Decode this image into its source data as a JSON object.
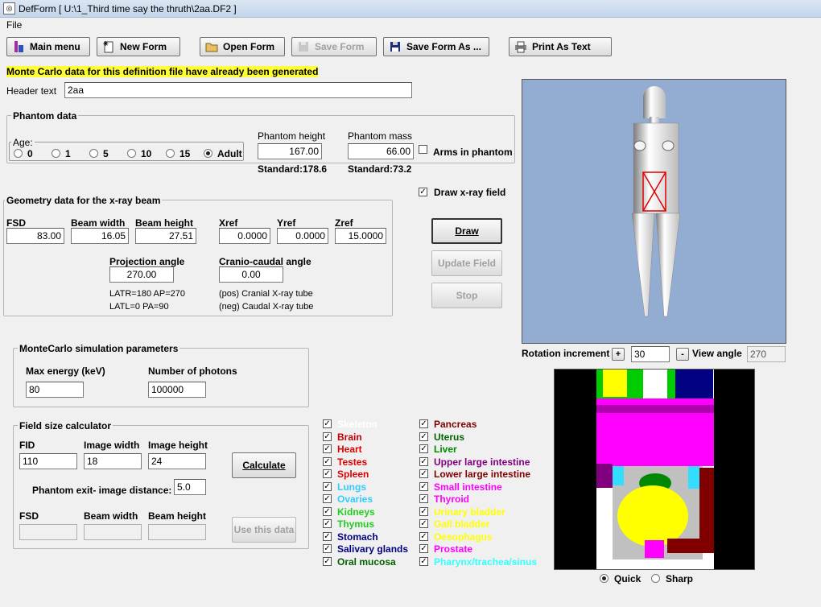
{
  "window": {
    "title": "DefForm  [ U:\\1_Third time say the thruth\\2aa.DF2 ]"
  },
  "menu": {
    "file": "File"
  },
  "toolbar": {
    "main_menu": "Main menu",
    "new_form": "New Form",
    "open_form": "Open Form",
    "save_form": "Save Form",
    "save_form_as": "Save Form As ...",
    "print_as_text": "Print As Text"
  },
  "warning": "Monte Carlo data for this definition file have already been  generated",
  "header": {
    "label": "Header text",
    "value": "2aa"
  },
  "phantom": {
    "title": "Phantom data",
    "age_label": "Age:",
    "ages": [
      "0",
      "1",
      "5",
      "10",
      "15",
      "Adult"
    ],
    "selected_age": "Adult",
    "height_label": "Phantom height",
    "height_value": "167.00",
    "height_standard": "Standard:178.6",
    "mass_label": "Phantom mass",
    "mass_value": "66.00",
    "mass_standard": "Standard:73.2",
    "arms_label": "Arms in phantom"
  },
  "geometry": {
    "title": "Geometry data for the x-ray beam",
    "fsd_label": "FSD",
    "fsd": "83.00",
    "bw_label": "Beam width",
    "bw": "16.05",
    "bh_label": "Beam height",
    "bh": "27.51",
    "xref_label": "Xref",
    "xref": "0.0000",
    "yref_label": "Yref",
    "yref": "0.0000",
    "zref_label": "Zref",
    "zref": "15.0000",
    "proj_label": "Projection angle",
    "proj": "270.00",
    "cc_label": "Cranio-caudal angle",
    "cc": "0.00",
    "note1": "LATR=180  AP=270",
    "note2": "LATL=0     PA=90",
    "note3": "(pos) Cranial X-ray tube",
    "note4": "(neg) Caudal X-ray tube"
  },
  "draw_field": {
    "label": "Draw x-ray field"
  },
  "actions": {
    "draw": "Draw",
    "update": "Update Field",
    "stop": "Stop"
  },
  "montecarlo": {
    "title": "MonteCarlo simulation parameters",
    "energy_label": "Max energy (keV)",
    "energy": "80",
    "photons_label": "Number of photons",
    "photons": "100000"
  },
  "fieldcalc": {
    "title": "Field size calculator",
    "fid_label": "FID",
    "fid": "110",
    "iw_label": "Image width",
    "iw": "18",
    "ih_label": "Image height",
    "ih": "24",
    "calculate": "Calculate",
    "exit_label": "Phantom exit- image distance:",
    "exit": "5.0",
    "fsd_label": "FSD",
    "bw_label": "Beam width",
    "bh_label": "Beam height",
    "use": "Use this data"
  },
  "rotation": {
    "label": "Rotation increment",
    "plus": "+",
    "value": "30",
    "minus": "-",
    "view_label": "View angle",
    "view": "270"
  },
  "render_mode": {
    "quick": "Quick",
    "sharp": "Sharp",
    "selected": "Quick"
  },
  "organs_left": [
    {
      "name": "Skeleton",
      "color": "#ffffff"
    },
    {
      "name": "Brain",
      "color": "#c00000"
    },
    {
      "name": "Heart",
      "color": "#e00000"
    },
    {
      "name": "Testes",
      "color": "#e00000"
    },
    {
      "name": "Spleen",
      "color": "#e00000"
    },
    {
      "name": "Lungs",
      "color": "#33ccff"
    },
    {
      "name": "Ovaries",
      "color": "#33ccff"
    },
    {
      "name": "Kidneys",
      "color": "#22cc22"
    },
    {
      "name": "Thymus",
      "color": "#22cc22"
    },
    {
      "name": "Stomach",
      "color": "#000080"
    },
    {
      "name": "Salivary glands",
      "color": "#000080"
    },
    {
      "name": "Oral mucosa",
      "color": "#006000"
    }
  ],
  "organs_right": [
    {
      "name": "Pancreas",
      "color": "#800000"
    },
    {
      "name": "Uterus",
      "color": "#006600"
    },
    {
      "name": "Liver",
      "color": "#008800"
    },
    {
      "name": "Upper large intestine",
      "color": "#800080"
    },
    {
      "name": "Lower large intestine",
      "color": "#800000"
    },
    {
      "name": "Small intestine",
      "color": "#ff00ff"
    },
    {
      "name": "Thyroid",
      "color": "#ff00ff"
    },
    {
      "name": "Urinary bladder",
      "color": "#ffff00"
    },
    {
      "name": "Gall bladder",
      "color": "#ffff00"
    },
    {
      "name": "Oesophagus",
      "color": "#ffff00"
    },
    {
      "name": "Prostate",
      "color": "#ff00ff"
    },
    {
      "name": "Pharynx/trachea/sinus",
      "color": "#33ffff"
    }
  ]
}
